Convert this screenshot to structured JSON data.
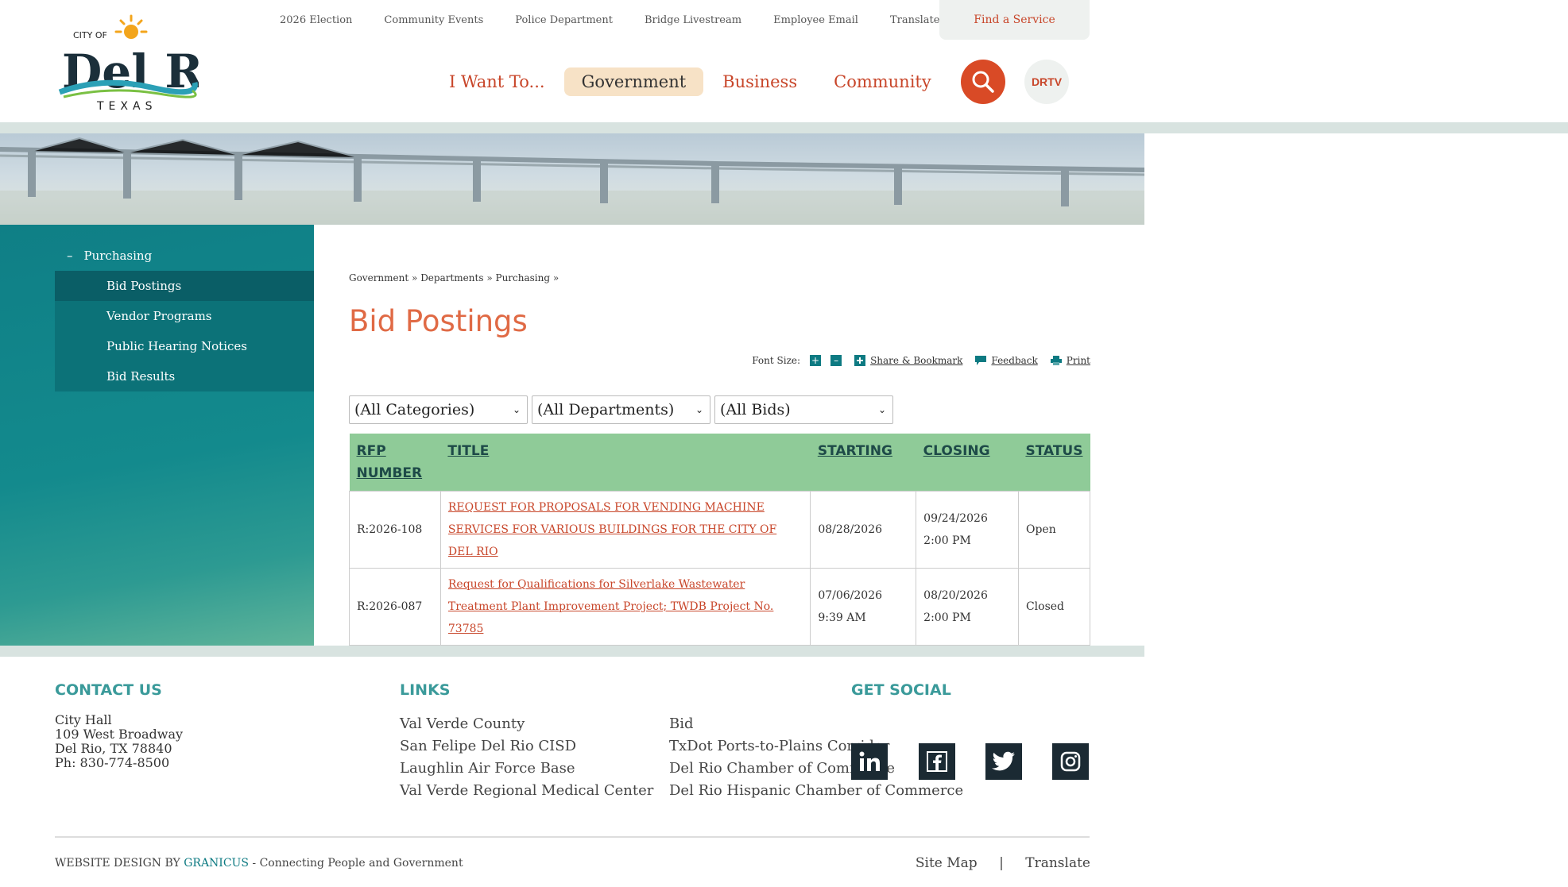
{
  "header": {
    "logo": {
      "top": "CITY OF",
      "name": "Del Rio",
      "state": "TEXAS"
    },
    "utility_links": [
      "2026 Election",
      "Community Events",
      "Police Department",
      "Bridge Livestream",
      "Employee Email",
      "Translate"
    ],
    "find_service": "Find a Service",
    "main_nav": [
      {
        "label": "I Want To..."
      },
      {
        "label": "Government",
        "active": true
      },
      {
        "label": "Business"
      },
      {
        "label": "Community"
      }
    ],
    "drtv_label": "DRTV"
  },
  "sidebar": {
    "heading": "Purchasing",
    "minus": "–",
    "items": [
      {
        "label": "Bid Postings",
        "active": true
      },
      {
        "label": "Vendor Programs"
      },
      {
        "label": "Public Hearing Notices"
      },
      {
        "label": "Bid Results"
      }
    ]
  },
  "content": {
    "breadcrumb": [
      "Government",
      "Departments",
      "Purchasing"
    ],
    "breadcrumb_sep": "»",
    "title": "Bid Postings",
    "tools": {
      "font_size_label": "Font Size:",
      "plus": "+",
      "minus": "–",
      "share": "Share & Bookmark",
      "feedback": "Feedback",
      "print": "Print"
    },
    "filters": [
      "(All Categories)",
      "(All Departments)",
      "(All Bids)"
    ],
    "filter_chevron": "⌄",
    "table": {
      "headers": [
        "RFP NUMBER",
        "TITLE",
        "STARTING",
        "CLOSING",
        "STATUS"
      ],
      "rows": [
        {
          "rfp": "R:2026-108",
          "title": "REQUEST FOR PROPOSALS FOR VENDING MACHINE SERVICES FOR VARIOUS BUILDINGS FOR THE CITY OF DEL RIO",
          "starting": "08/28/2026",
          "closing": "09/24/2026 2:00 PM",
          "status": "Open"
        },
        {
          "rfp": "R:2026-087",
          "title": "Request for Qualifications for Silverlake Wastewater Treatment Plant Improvement Project; TWDB Project No. 73785",
          "starting": "07/06/2026 9:39 AM",
          "closing": "08/20/2026 2:00 PM",
          "status": "Closed"
        }
      ]
    }
  },
  "footer": {
    "contact_heading": "CONTACT US",
    "contact_lines": [
      "City Hall",
      "109 West Broadway",
      "Del Rio, TX 78840",
      "Ph: 830-774-8500"
    ],
    "links_heading": "LINKS",
    "links_col1": [
      "Val Verde County",
      "San Felipe Del Rio CISD",
      "Laughlin Air Force Base",
      "Val Verde Regional Medical Center"
    ],
    "links_col2": [
      "Bid",
      "TxDot Ports-to-Plains Corridor",
      "Del Rio Chamber of Commerce",
      "Del Rio Hispanic Chamber of Commerce"
    ],
    "social_heading": "GET SOCIAL",
    "social": [
      "linkedin-icon",
      "facebook-icon",
      "twitter-icon",
      "instagram-icon"
    ],
    "credit_prefix": "WEBSITE DESIGN BY",
    "credit_brand": "GRANICUS",
    "credit_suffix": "- Connecting People and Government",
    "bottom_links": [
      "Site Map",
      "Translate"
    ],
    "bottom_sep": "|"
  }
}
